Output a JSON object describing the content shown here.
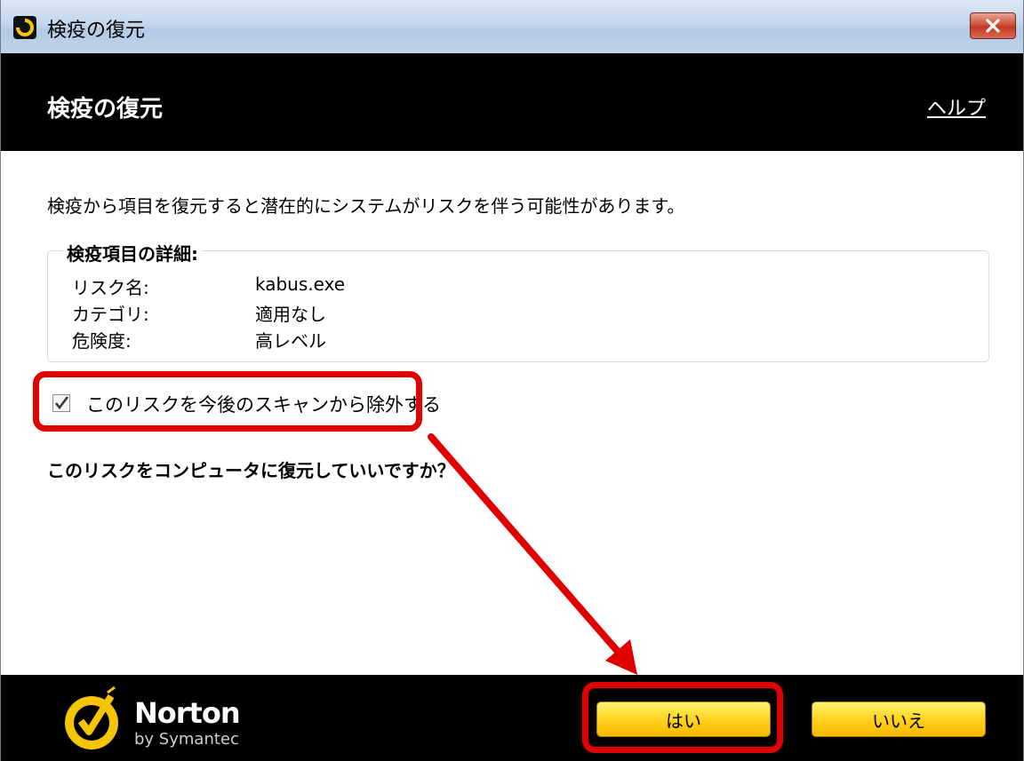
{
  "window": {
    "title": "検疫の復元"
  },
  "header": {
    "title": "検疫の復元",
    "help_link": "ヘルプ"
  },
  "main": {
    "warning": "検疫から項目を復元すると潜在的にシステムがリスクを伴う可能性があります。",
    "details": {
      "heading": "検疫項目の詳細:",
      "rows": [
        {
          "label": "リスク名:",
          "value": "kabus.exe"
        },
        {
          "label": "カテゴリ:",
          "value": "適用なし"
        },
        {
          "label": "危険度:",
          "value": "高レベル"
        }
      ]
    },
    "exclude_checkbox": {
      "label": "このリスクを今後のスキャンから除外する",
      "checked": true
    },
    "question": "このリスクをコンピュータに復元していいですか？"
  },
  "footer": {
    "brand_name": "Norton",
    "brand_sub": "by Symantec",
    "yes_button": "はい",
    "no_button": "いいえ"
  },
  "colors": {
    "accent_yellow": "#ffd21e",
    "annotation_red": "#e10000",
    "header_bg": "#000000"
  },
  "icons": {
    "app": "norton-app-icon",
    "close": "close-icon",
    "check": "checkmark-icon"
  }
}
